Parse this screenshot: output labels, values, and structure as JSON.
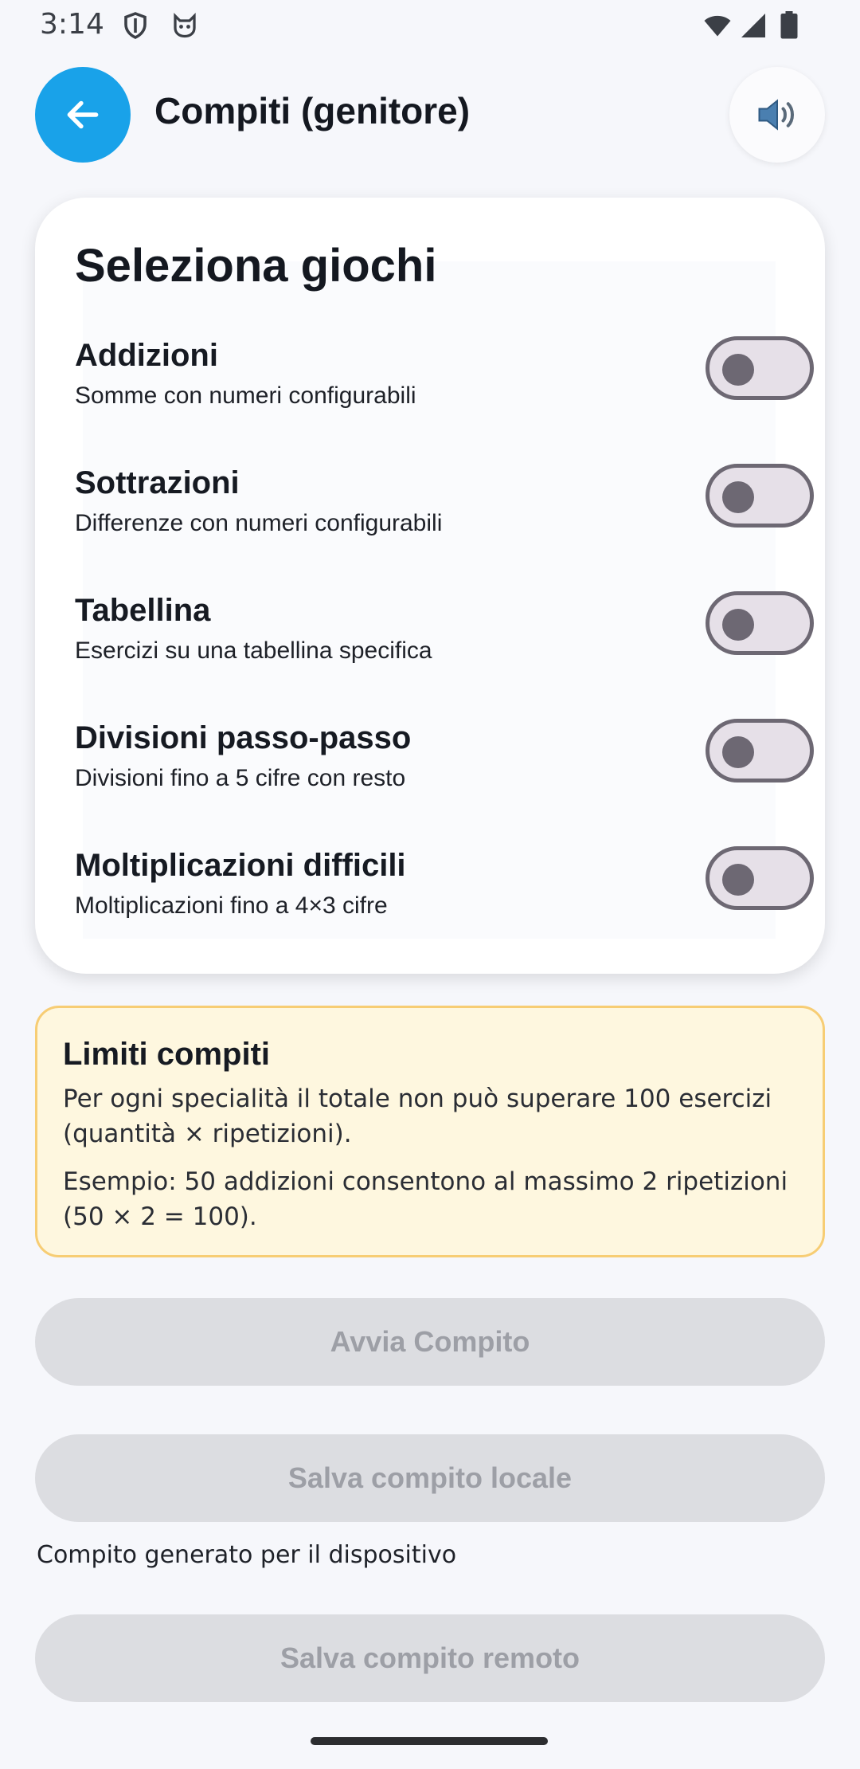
{
  "status_bar": {
    "time": "3:14",
    "left_icons": [
      "shield-icon",
      "cat-face-icon"
    ],
    "right_icons": [
      "wifi-icon",
      "cellular-signal-icon",
      "battery-icon"
    ]
  },
  "app_bar": {
    "title": "Compiti (genitore)",
    "back_icon": "arrow-left-icon",
    "sound_icon": "speaker-icon",
    "accent_color": "#19a2e9"
  },
  "games_card": {
    "title": "Seleziona giochi",
    "games": [
      {
        "name": "Addizioni",
        "description": "Somme con numeri configurabili",
        "enabled": false
      },
      {
        "name": "Sottrazioni",
        "description": "Differenze con numeri configurabili",
        "enabled": false
      },
      {
        "name": "Tabellina",
        "description": "Esercizi su una tabellina specifica",
        "enabled": false
      },
      {
        "name": "Divisioni passo-passo",
        "description": "Divisioni fino a 5 cifre con resto",
        "enabled": false
      },
      {
        "name": "Moltiplicazioni difficili",
        "description": "Moltiplicazioni fino a 4×3 cifre",
        "enabled": false
      }
    ]
  },
  "limits": {
    "title": "Limiti compiti",
    "text1": "Per ogni specialità il totale non può superare 100 esercizi (quantità × ripetizioni).",
    "text2": "Esempio: 50 addizioni consentono al massimo 2 ripetizioni (50 × 2 = 100).",
    "border_color": "#f7cd74",
    "background_color": "#fef7df"
  },
  "actions": {
    "start_label": "Avvia Compito",
    "save_local_label": "Salva compito locale",
    "local_caption": "Compito generato per il dispositivo",
    "save_remote_label": "Salva compito remoto",
    "disabled_color": "#dcdde1"
  }
}
